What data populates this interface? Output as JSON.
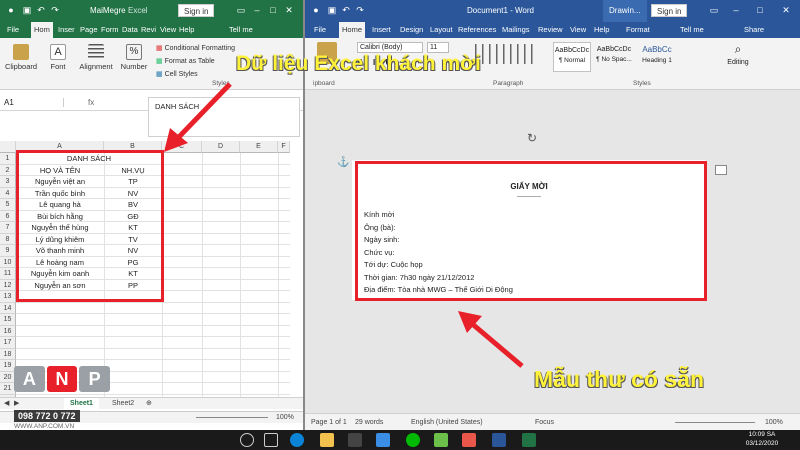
{
  "excel": {
    "title": "MaiMegre",
    "product": "Excel",
    "sign_in": "Sign in",
    "tabs": [
      "File",
      "Hom",
      "Inser",
      "Page",
      "Form",
      "Data",
      "Revi",
      "View",
      "Help",
      "Tell me"
    ],
    "ribbon": {
      "clipboard": "Clipboard",
      "font": "Font",
      "alignment": "Alignment",
      "number": "Number",
      "conditional": "Conditional Formatting",
      "format_table": "Format as Table",
      "cell_styles": "Cell Styles",
      "styles_group": "Styles"
    },
    "name_box": "A1",
    "formula_value": "DANH SÁCH",
    "columns": [
      "A",
      "B",
      "C",
      "D",
      "E",
      "F"
    ],
    "rows": [
      "1",
      "2",
      "3",
      "4",
      "5",
      "6",
      "7",
      "8",
      "9",
      "10",
      "11",
      "12",
      "13",
      "14",
      "15",
      "16",
      "17",
      "18",
      "19",
      "20",
      "21",
      "22"
    ],
    "table_title": "DANH SÁCH",
    "header": {
      "name": "HỌ VÀ TÊN",
      "role": "NH.VỤ"
    },
    "guests": [
      {
        "name": "Nguyễn việt an",
        "role": "TP"
      },
      {
        "name": "Trần quốc bình",
        "role": "NV"
      },
      {
        "name": "Lê quang hà",
        "role": "BV"
      },
      {
        "name": "Bùi bích hằng",
        "role": "GĐ"
      },
      {
        "name": "Nguyễn thế hùng",
        "role": "KT"
      },
      {
        "name": "Lý dũng khiêm",
        "role": "TV"
      },
      {
        "name": "Võ thanh minh",
        "role": "NV"
      },
      {
        "name": "Lê hoàng nam",
        "role": "PG"
      },
      {
        "name": "Nguyễn kim oanh",
        "role": "KT"
      },
      {
        "name": "Nguyễn an sơn",
        "role": "PP"
      }
    ],
    "sheets": [
      "Sheet1",
      "Sheet2"
    ],
    "zoom": "100%"
  },
  "word": {
    "title": "Document1 - Word",
    "drawing": "Drawin...",
    "sign_in": "Sign in",
    "tabs": [
      "File",
      "Home",
      "Insert",
      "Design",
      "Layout",
      "References",
      "Mailings",
      "Review",
      "View",
      "Help",
      "Format",
      "Tell me",
      "Share"
    ],
    "font_name": "Calibri (Body)",
    "font_size": "11",
    "styles": [
      {
        "sample": "AaBbCcDc",
        "name": "¶ Normal"
      },
      {
        "sample": "AaBbCcDc",
        "name": "¶ No Spac..."
      },
      {
        "sample": "AaBbCc",
        "name": "Heading 1"
      }
    ],
    "groups": {
      "clipboard": "ipboard",
      "paragraph": "Paragraph",
      "styles": "Styles",
      "editing": "Editing"
    },
    "letter": {
      "title": "GIẤY MỜI",
      "separator": "------------",
      "lines": [
        "Kính mời",
        "Ông (bà):",
        "Ngày sinh:",
        "Chức vụ:",
        "Tới dự: Cuộc họp",
        "Thời gian: 7h30 ngày 21/12/2012",
        "Địa điểm: Tòa nhà MWG – Thế Giới Di Động"
      ]
    },
    "status": {
      "page": "Page 1 of 1",
      "words": "29 words",
      "language": "English (United States)",
      "focus": "Focus",
      "zoom": "100%"
    }
  },
  "annotations": {
    "top": "Dữ liệu Excel khách mời",
    "bottom": "Mẫu thư có sẵn"
  },
  "watermark": {
    "logo": "ANP",
    "phone": "098 772 0 772",
    "site": "WWW.ANP.COM.VN"
  },
  "taskbar": {
    "time": "10:09 SA",
    "date": "03/12/2020"
  },
  "colors": {
    "excel_green": "#217346",
    "word_blue": "#2b579a",
    "annotation_red": "#e8202a",
    "caption_yellow": "#fff23a"
  }
}
